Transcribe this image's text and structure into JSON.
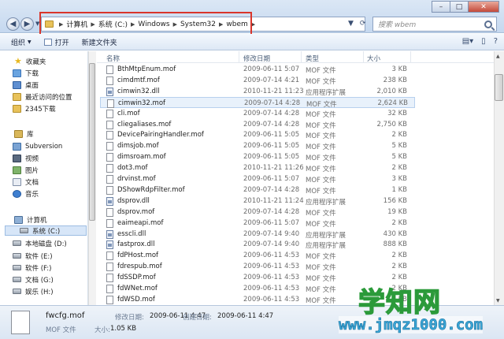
{
  "address": {
    "crumbs": [
      "计算机",
      "系统 (C:)",
      "Windows",
      "System32",
      "wbem"
    ]
  },
  "search": {
    "placeholder": "搜索 wbem"
  },
  "toolbar": {
    "organize": "组织",
    "open": "打开",
    "new_folder": "新建文件夹"
  },
  "nav": {
    "favorites": "收藏夹",
    "downloads": "下载",
    "desktop": "桌面",
    "recent": "最近访问的位置",
    "downloads2345": "2345下载",
    "libraries": "库",
    "subversion": "Subversion",
    "videos": "视频",
    "pictures": "图片",
    "documents": "文档",
    "music": "音乐",
    "computer": "计算机",
    "drives": [
      "系统 (C:)",
      "本地磁盘 (D:)",
      "软件 (E:)",
      "软件 (F:)",
      "文档 (G:)",
      "娱乐 (H:)"
    ]
  },
  "columns": {
    "name": "名称",
    "date": "修改日期",
    "type": "类型",
    "size": "大小"
  },
  "files": [
    {
      "name": "BthMtpEnum.mof",
      "date": "2009-06-11 5:07",
      "type": "MOF 文件",
      "size": "3 KB",
      "icon": "mof-file-icon"
    },
    {
      "name": "cimdmtf.mof",
      "date": "2009-07-14 4:21",
      "type": "MOF 文件",
      "size": "238 KB",
      "icon": "mof-file-icon"
    },
    {
      "name": "cimwin32.dll",
      "date": "2010-11-21 11:23",
      "type": "应用程序扩展",
      "size": "2,010 KB",
      "icon": "dll-file-icon"
    },
    {
      "name": "cimwin32.mof",
      "date": "2009-07-14 4:28",
      "type": "MOF 文件",
      "size": "2,624 KB",
      "icon": "mof-file-icon"
    },
    {
      "name": "cli.mof",
      "date": "2009-07-14 4:28",
      "type": "MOF 文件",
      "size": "32 KB",
      "icon": "mof-file-icon"
    },
    {
      "name": "cliegaliases.mof",
      "date": "2009-07-14 4:28",
      "type": "MOF 文件",
      "size": "2,750 KB",
      "icon": "mof-file-icon"
    },
    {
      "name": "DevicePairingHandler.mof",
      "date": "2009-06-11 5:05",
      "type": "MOF 文件",
      "size": "2 KB",
      "icon": "mof-file-icon"
    },
    {
      "name": "dimsjob.mof",
      "date": "2009-06-11 5:05",
      "type": "MOF 文件",
      "size": "5 KB",
      "icon": "mof-file-icon"
    },
    {
      "name": "dimsroam.mof",
      "date": "2009-06-11 5:05",
      "type": "MOF 文件",
      "size": "5 KB",
      "icon": "mof-file-icon"
    },
    {
      "name": "dot3.mof",
      "date": "2010-11-21 11:26",
      "type": "MOF 文件",
      "size": "2 KB",
      "icon": "mof-file-icon"
    },
    {
      "name": "drvinst.mof",
      "date": "2009-06-11 5:07",
      "type": "MOF 文件",
      "size": "3 KB",
      "icon": "mof-file-icon"
    },
    {
      "name": "DShowRdpFilter.mof",
      "date": "2009-07-14 4:28",
      "type": "MOF 文件",
      "size": "1 KB",
      "icon": "mof-file-icon"
    },
    {
      "name": "dsprov.dll",
      "date": "2010-11-21 11:24",
      "type": "应用程序扩展",
      "size": "156 KB",
      "icon": "dll-file-icon"
    },
    {
      "name": "dsprov.mof",
      "date": "2009-07-14 4:28",
      "type": "MOF 文件",
      "size": "19 KB",
      "icon": "mof-file-icon"
    },
    {
      "name": "eaimeapi.mof",
      "date": "2009-06-11 5:07",
      "type": "MOF 文件",
      "size": "2 KB",
      "icon": "mof-file-icon"
    },
    {
      "name": "esscli.dll",
      "date": "2009-07-14 9:40",
      "type": "应用程序扩展",
      "size": "430 KB",
      "icon": "dll-file-icon"
    },
    {
      "name": "fastprox.dll",
      "date": "2009-07-14 9:40",
      "type": "应用程序扩展",
      "size": "888 KB",
      "icon": "dll-file-icon"
    },
    {
      "name": "fdPHost.mof",
      "date": "2009-06-11 4:53",
      "type": "MOF 文件",
      "size": "2 KB",
      "icon": "mof-file-icon"
    },
    {
      "name": "fdrespub.mof",
      "date": "2009-06-11 4:53",
      "type": "MOF 文件",
      "size": "2 KB",
      "icon": "mof-file-icon"
    },
    {
      "name": "fdSSDP.mof",
      "date": "2009-06-11 4:53",
      "type": "MOF 文件",
      "size": "2 KB",
      "icon": "mof-file-icon"
    },
    {
      "name": "fdWNet.mof",
      "date": "2009-06-11 4:53",
      "type": "MOF 文件",
      "size": "2 KB",
      "icon": "mof-file-icon"
    },
    {
      "name": "fdWSD.mof",
      "date": "2009-06-11 4:53",
      "type": "MOF 文件",
      "size": "2 KB",
      "icon": "mof-file-icon"
    }
  ],
  "details": {
    "name": "fwcfg.mof",
    "date_label": "修改日期:",
    "date_value": "2009-06-11 4:47",
    "created_label": "创建日期:",
    "created_value": "2009-06-11 4:47",
    "type": "MOF 文件",
    "size_label": "大小:",
    "size_value": "1.05 KB"
  },
  "watermark": {
    "title": "学知网",
    "url": "www.jmqz1000.com"
  },
  "colors": {
    "highlight_border": "#d9352b",
    "selection": "#d7e6f8",
    "watermark_green": "#2b9a3a",
    "watermark_blue": "#3aa7d8"
  }
}
